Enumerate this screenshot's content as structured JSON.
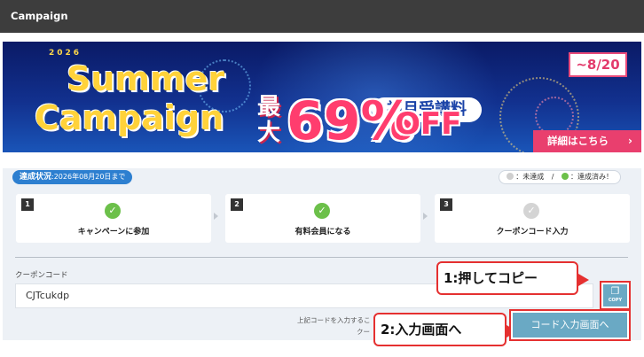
{
  "topbar": {
    "title": "Campaign"
  },
  "banner": {
    "year": "2026",
    "title_line1": "Summer",
    "title_line2": "Campaign",
    "max_label": "最大",
    "first_month_label": "初月受講料",
    "discount_percent": "69%",
    "off_label": "OFF",
    "period": "~8/20",
    "detail_link": "詳細はこちら",
    "colors": {
      "pink": "#e93f6e",
      "yellow": "#ffd23a",
      "navy": "#0a1a66"
    }
  },
  "status": {
    "tag_label": "達成状況",
    "tag_date": ":2026年08月20日まで",
    "legend_not": "：未達成",
    "legend_sep": "/",
    "legend_done": "：達成済み！"
  },
  "steps": [
    {
      "num": "1",
      "label": "キャンペーンに参加",
      "done": true
    },
    {
      "num": "2",
      "label": "有料会員になる",
      "done": true
    },
    {
      "num": "3",
      "label": "クーポンコード入力",
      "done": false
    }
  ],
  "coupon": {
    "label": "クーポンコード",
    "value": "CJTcukdp",
    "copy_label": "COPY",
    "note_line1": "上記コードを入力するこ",
    "note_line2": "クー",
    "go_button": "コード入力画面へ"
  },
  "callouts": {
    "copy": "1:押してコピー",
    "go": "2:入力画面へ"
  }
}
